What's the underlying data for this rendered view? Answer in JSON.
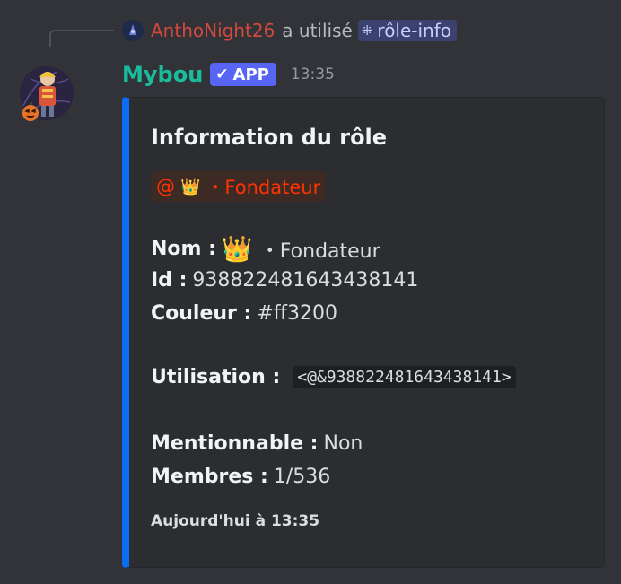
{
  "reply": {
    "user": "AnthoNight26",
    "action": "a utilisé",
    "command": "rôle-info",
    "command_icon": "slash-command-icon"
  },
  "message": {
    "username": "Mybou",
    "badge": "APP",
    "timestamp": "13:35"
  },
  "embed": {
    "accent_color": "#0b6cf5",
    "title": "Information du rôle",
    "role_mention": {
      "at": "@",
      "crown": "👑",
      "name": "・Fondateur",
      "color": "#ff3200"
    },
    "fields": {
      "nom_label": "Nom :",
      "nom_crown": "👑",
      "nom_value": "・Fondateur",
      "id_label": "Id :",
      "id_value": "938822481643438141",
      "couleur_label": "Couleur :",
      "couleur_value": "#ff3200",
      "utilisation_label": "Utilisation :",
      "utilisation_value": "<@&938822481643438141>",
      "mentionnable_label": "Mentionnable :",
      "mentionnable_value": "Non",
      "membres_label": "Membres :",
      "membres_value": "1/536"
    },
    "footer": "Aujourd'hui à 13:35"
  }
}
